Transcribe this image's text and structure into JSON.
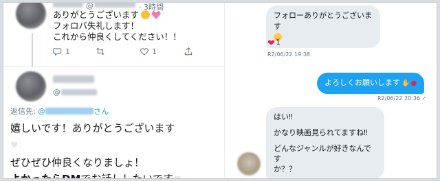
{
  "tweet_reply": {
    "handle_prefix": "@",
    "time_suffix": "· 3時間",
    "lines": [
      "ありがとうございます",
      "フォロバ失礼します！",
      "これから仲良くしてください！！"
    ],
    "actions": {
      "reply_count": "1",
      "retweet_count": "",
      "like_count": "1",
      "share_label": ""
    }
  },
  "tweet_main": {
    "handle_prefix": "@",
    "reply_to_label": "返信先:",
    "reply_to_at": "@",
    "reply_to_suffix": "さん",
    "lines": [
      "嬉しいです！ありがとうございます",
      "ぜひぜひ仲良くなりましょ！"
    ],
    "last_line_bold": "よかったらDM",
    "last_line_rest": "でお話ししたいです"
  },
  "dm": {
    "messages": [
      {
        "text": "フォローありがとうございます",
        "direction": "in"
      },
      {
        "text": "よろしくお願いします",
        "direction": "out"
      },
      {
        "direction": "in",
        "lines": [
          "はい‼",
          "かなり映画見られてますね‼",
          "どんなジャンルが好きなんです",
          "か？？"
        ]
      }
    ],
    "msg1_reaction_count": "1",
    "msg1_time": "R2/06/22 19:38",
    "msg2_time": "R2/06/22 20:36 ✓",
    "accent": "#1da1f2"
  }
}
